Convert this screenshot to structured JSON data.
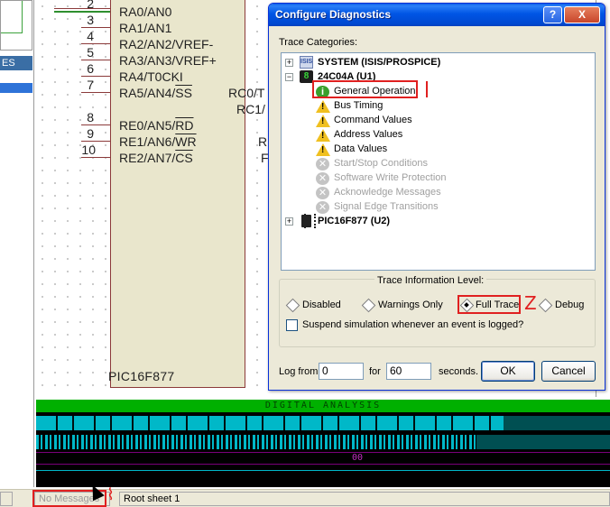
{
  "schematic": {
    "chip_name": "PIC16F877",
    "pins": [
      {
        "num": "2",
        "label": "RA0/AN0"
      },
      {
        "num": "3",
        "label": "RA1/AN1"
      },
      {
        "num": "4",
        "label": "RA2/AN2/VREF-"
      },
      {
        "num": "5",
        "label": "RA3/AN3/VREF+"
      },
      {
        "num": "6",
        "label": "RA4/T0CKI"
      },
      {
        "num": "7",
        "label_pre": "RA5/AN4/",
        "label_ol": "SS"
      },
      {
        "num": "8",
        "label_pre": "RE0/AN5/",
        "label_ol": "RD"
      },
      {
        "num": "9",
        "label_pre": "RE1/AN6/",
        "label_ol": "WR"
      },
      {
        "num": "10",
        "label_pre": "RE2/AN7/",
        "label_ol": "CS"
      }
    ],
    "right_labels": [
      "RC0/T",
      "RC1/",
      "R",
      "F"
    ],
    "left_panel_header": "ES"
  },
  "analysis": {
    "title": "DIGITAL ANALYSIS",
    "bus_value": "00"
  },
  "statusbar": {
    "messages": "No Messages",
    "sheet": "Root sheet 1"
  },
  "dialog": {
    "title": "Configure Diagnostics",
    "title_buttons": {
      "help": "?",
      "close": "X"
    },
    "trace_categories_label": "Trace Categories:",
    "tree": {
      "system": {
        "icon_text": "ISIS",
        "label": "SYSTEM (ISIS/PROSPICE)"
      },
      "device1": {
        "icon_text": "8",
        "label": "24C04A (U1)",
        "children": [
          {
            "label": "General Operation",
            "icon": "info-icon",
            "enabled": true
          },
          {
            "label": "Bus Timing",
            "icon": "warning-icon",
            "enabled": true
          },
          {
            "label": "Command Values",
            "icon": "warning-icon",
            "enabled": true
          },
          {
            "label": "Address Values",
            "icon": "warning-icon",
            "enabled": true
          },
          {
            "label": "Data Values",
            "icon": "warning-icon",
            "enabled": true
          },
          {
            "label": "Start/Stop Conditions",
            "icon": "disabled-icon",
            "enabled": false
          },
          {
            "label": "Software Write Protection",
            "icon": "disabled-icon",
            "enabled": false
          },
          {
            "label": "Acknowledge Messages",
            "icon": "disabled-icon",
            "enabled": false
          },
          {
            "label": "Signal Edge Transitions",
            "icon": "disabled-icon",
            "enabled": false
          }
        ]
      },
      "device2": {
        "label": "PIC16F877 (U2)"
      }
    },
    "trace_level": {
      "label": "Trace Information Level:",
      "options": [
        "Disabled",
        "Warnings Only",
        "Full Trace",
        "Debug"
      ],
      "selected": "Full Trace"
    },
    "suspend_label": "Suspend simulation whenever an event is logged?",
    "suspend_checked": false,
    "log_from_label": "Log from",
    "log_from_value": "0",
    "for_label": "for",
    "for_value": "60",
    "seconds_label": "seconds.",
    "ok_label": "OK",
    "cancel_label": "Cancel"
  },
  "colors": {
    "annotation_red": "#e02020",
    "xp_title_blue": "#0055e5",
    "trace_cyan": "#00b8c8",
    "analysis_green": "#00b000"
  }
}
